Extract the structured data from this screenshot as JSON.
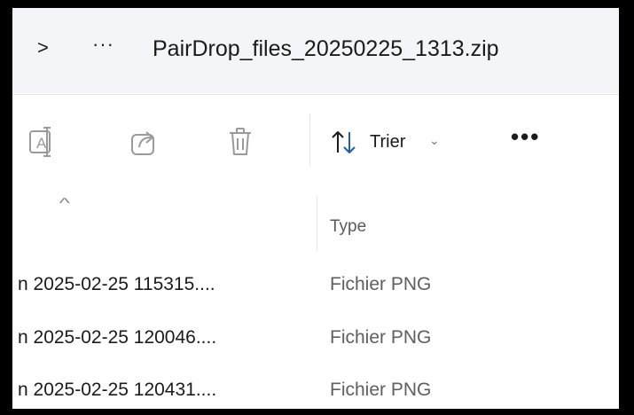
{
  "address": {
    "chevron": ">",
    "more": "···",
    "crumb": "PairDrop_files_20250225_1313.zip"
  },
  "toolbar": {
    "icons": [
      "rename-icon",
      "share-icon",
      "delete-icon"
    ],
    "sort_label": "Trier",
    "sort_chevron": "⌄",
    "more": "•••"
  },
  "columns": {
    "sort_caret": "^",
    "type_header": "Type"
  },
  "files": [
    {
      "name": "n 2025-02-25 115315....",
      "type": "Fichier PNG"
    },
    {
      "name": "n 2025-02-25 120046....",
      "type": "Fichier PNG"
    },
    {
      "name": "n 2025-02-25 120431....",
      "type": "Fichier PNG"
    }
  ],
  "colors": {
    "address_bg": "#f3f5f9",
    "text": "#1b1b1b",
    "muted_text": "#5f5f5f",
    "icon_gray": "#9a9a9a"
  }
}
